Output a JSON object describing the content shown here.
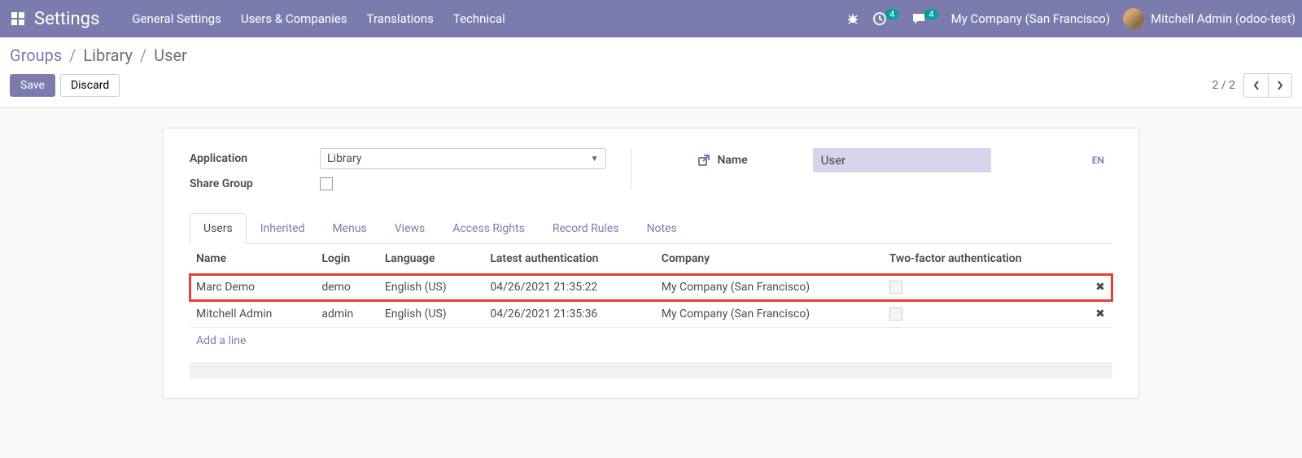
{
  "navbar": {
    "brand": "Settings",
    "links": [
      "General Settings",
      "Users & Companies",
      "Translations",
      "Technical"
    ],
    "activity_badge": "4",
    "message_badge": "4",
    "company": "My Company (San Francisco)",
    "user": "Mitchell Admin (odoo-test)"
  },
  "breadcrumb": {
    "root": "Groups",
    "middle": "Library",
    "current": "User"
  },
  "buttons": {
    "save": "Save",
    "discard": "Discard"
  },
  "pager": {
    "value": "2 / 2"
  },
  "form": {
    "application_label": "Application",
    "application_value": "Library",
    "share_group_label": "Share Group",
    "name_label": "Name",
    "name_value": "User",
    "lang_indicator": "EN"
  },
  "tabs": [
    "Users",
    "Inherited",
    "Menus",
    "Views",
    "Access Rights",
    "Record Rules",
    "Notes"
  ],
  "table": {
    "headers": [
      "Name",
      "Login",
      "Language",
      "Latest authentication",
      "Company",
      "Two-factor authentication"
    ],
    "rows": [
      {
        "name": "Marc Demo",
        "login": "demo",
        "language": "English (US)",
        "auth": "04/26/2021 21:35:22",
        "company": "My Company (San Francisco)",
        "twofa": false,
        "highlight": true
      },
      {
        "name": "Mitchell Admin",
        "login": "admin",
        "language": "English (US)",
        "auth": "04/26/2021 21:35:36",
        "company": "My Company (San Francisco)",
        "twofa": false,
        "highlight": false
      }
    ],
    "add_line": "Add a line"
  }
}
